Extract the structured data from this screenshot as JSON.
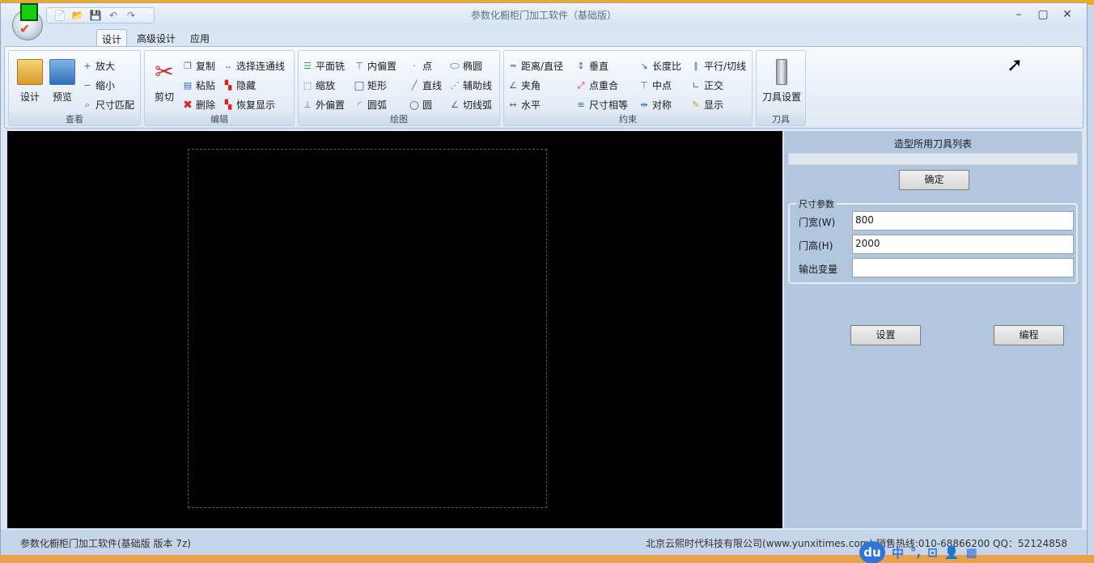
{
  "window": {
    "title": "参数化橱柜门加工软件（基础版）",
    "minimize": "–",
    "maximize": "▢",
    "close": "✕"
  },
  "qat": [
    "📄",
    "📂",
    "💾",
    "↶",
    "↷"
  ],
  "tabs": [
    {
      "label": "设计",
      "active": true
    },
    {
      "label": "高级设计",
      "active": false
    },
    {
      "label": "应用",
      "active": false
    }
  ],
  "ribbon": {
    "view": {
      "label": "查看",
      "design": "设计",
      "preview": "预览",
      "zoom_in": "放大",
      "zoom_out": "缩小",
      "fit": "尺寸匹配"
    },
    "edit": {
      "label": "编辑",
      "cut": "剪切",
      "copy": "复制",
      "paste": "粘贴",
      "delete": "删除",
      "select_chain": "选择连通线",
      "hide": "隐藏",
      "restore": "恢复显示"
    },
    "draw": {
      "label": "绘图",
      "plane_mill": "平面铣",
      "inner_offset": "内偏置",
      "point": "点",
      "ellipse": "椭圆",
      "scale": "缩放",
      "rect": "矩形",
      "line": "直线",
      "aux_line": "辅助线",
      "outer_offset": "外偏置",
      "arc": "圆弧",
      "circle": "圆",
      "tangent_arc": "切线弧"
    },
    "constraint": {
      "label": "约束",
      "distance": "距离/直径",
      "vertical": "垂直",
      "length_ratio": "长度比",
      "parallel": "平行/切线",
      "angle": "夹角",
      "coincident": "点重合",
      "midpoint": "中点",
      "perpendicular": "正交",
      "horizontal": "水平",
      "equal_size": "尺寸相等",
      "symmetric": "对称",
      "show": "显示"
    },
    "tool": {
      "label": "刀具",
      "tool_settings": "刀具设置"
    }
  },
  "panel": {
    "title": "造型所用刀具列表",
    "confirm": "确定",
    "legend": "尺寸参数",
    "width_label": "门宽(W)",
    "width_value": "800",
    "height_label": "门高(H)",
    "height_value": "2000",
    "output_label": "输出变量",
    "output_value": "",
    "settings_button": "设置",
    "program_button": "编程"
  },
  "status": {
    "left": "参数化橱柜门加工软件(基础版 版本 7z)",
    "right": "北京云熙时代科技有限公司(www.yunxitimes.com)  销售热线:010-68866200    QQ：52124858"
  },
  "ime": {
    "du": "du",
    "items": [
      "中",
      "°,",
      "⊡",
      "👤",
      "▦"
    ]
  }
}
